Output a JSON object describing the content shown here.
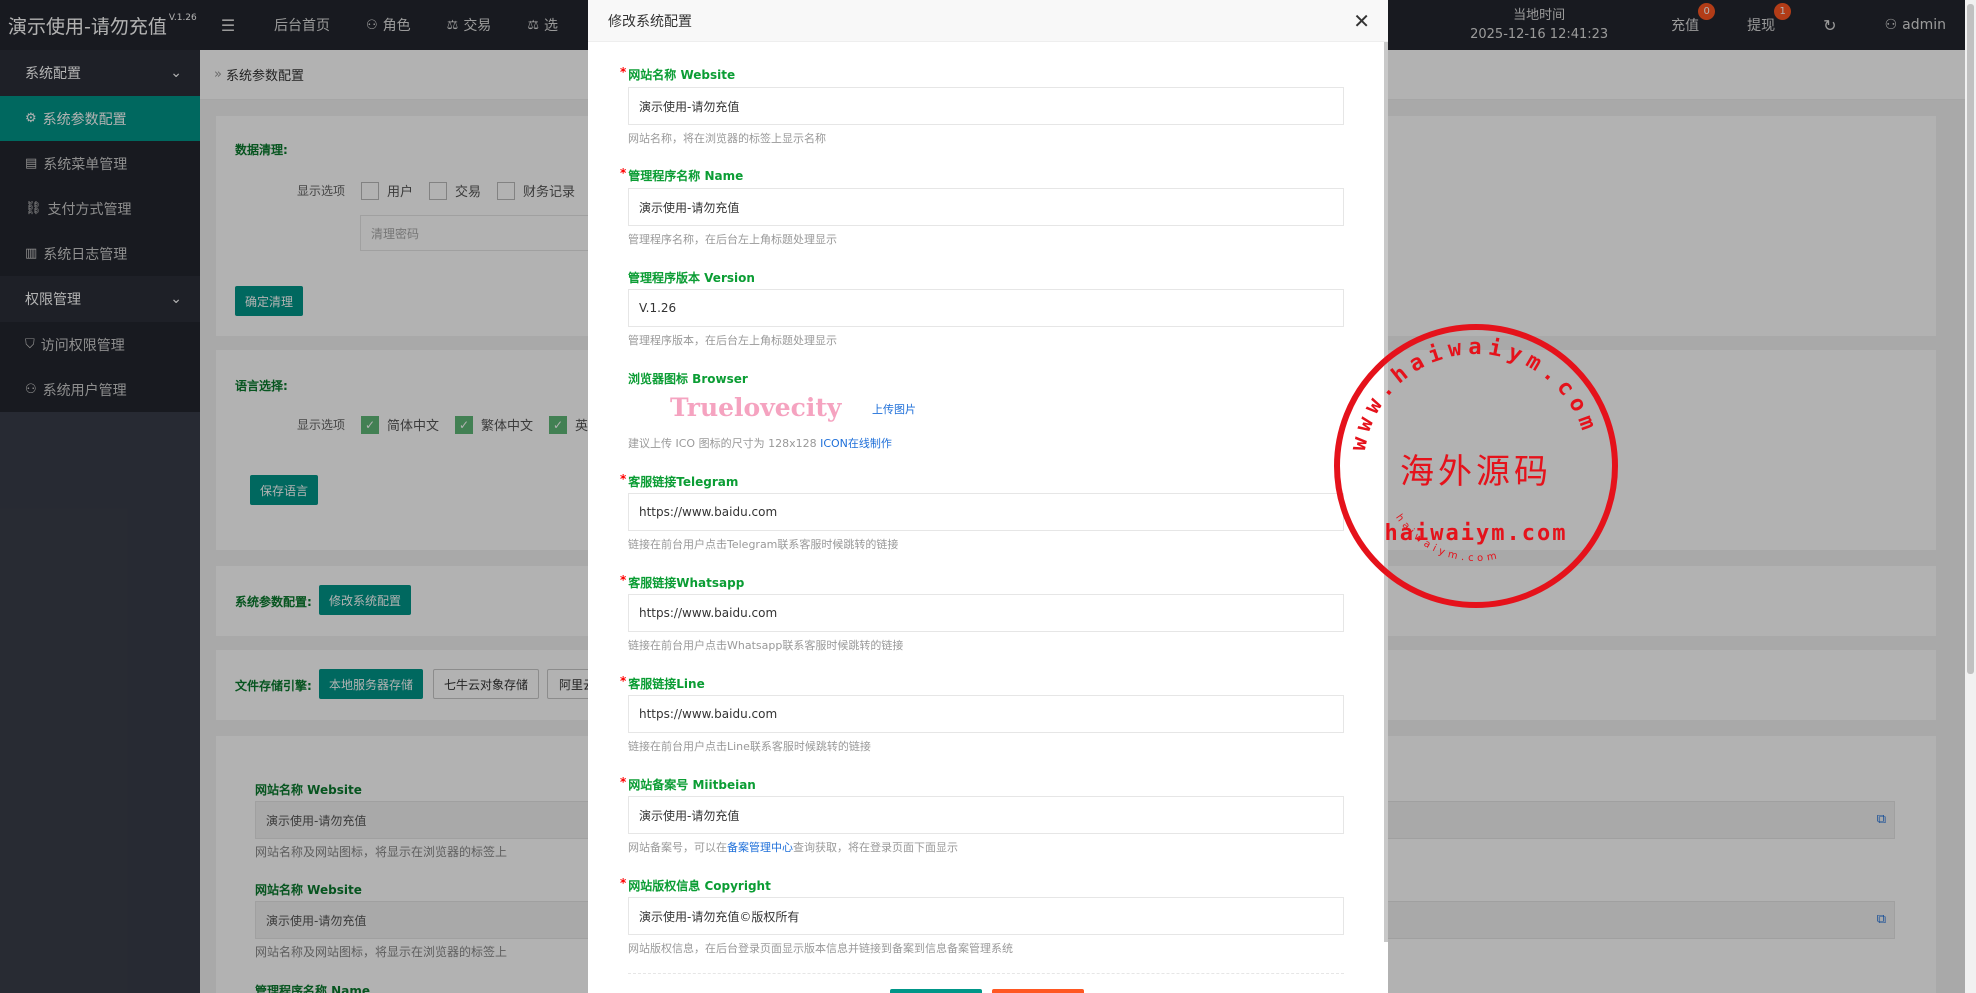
{
  "topbar": {
    "app_title": "演示使用-请勿充值",
    "version": "V.1.26",
    "nav": [
      {
        "label": "后台首页",
        "icon": "home-icon"
      },
      {
        "label": "角色",
        "icon": "user-icon"
      },
      {
        "label": "交易",
        "icon": "scale-icon"
      },
      {
        "label": "选",
        "icon": "scale-icon"
      }
    ],
    "clock_label": "当地时间",
    "clock_value": "2025-12-16 12:41:23",
    "recharge_label": "充值",
    "recharge_badge": "0",
    "withdraw_label": "提现",
    "withdraw_badge": "1",
    "user_label": "admin"
  },
  "sidebar": {
    "group1": "系统配置",
    "items1": [
      "系统参数配置",
      "系统菜单管理",
      "支付方式管理",
      "系统日志管理"
    ],
    "group2": "权限管理",
    "items2": [
      "访问权限管理",
      "系统用户管理"
    ]
  },
  "main": {
    "breadcrumb": "系统参数配置",
    "clean_label": "数据清理:",
    "display_options": "显示选项",
    "clean_options": [
      "用户",
      "交易",
      "财务记录"
    ],
    "clean_password_placeholder": "清理密码",
    "confirm_clean": "确定清理",
    "lang_label": "语言选择:",
    "lang_options": [
      "简体中文",
      "繁体中文",
      "英"
    ],
    "save_lang": "保存语言",
    "sys_config_label": "系统参数配置:",
    "edit_config_btn": "修改系统配置",
    "storage_label": "文件存储引擎:",
    "storage_options": [
      "本地服务器存储",
      "七牛云对象存储",
      "阿里云"
    ],
    "bg_fields": [
      {
        "label": "网站名称 Website",
        "value": "演示使用-请勿充值",
        "hint": "网站名称及网站图标，将显示在浏览器的标签上"
      },
      {
        "label": "网站名称 Website",
        "value": "演示使用-请勿充值",
        "hint": "网站名称及网站图标，将显示在浏览器的标签上"
      },
      {
        "label": "管理程序名称 Name"
      }
    ]
  },
  "modal": {
    "title": "修改系统配置",
    "fields": [
      {
        "label": "网站名称 Website",
        "required": true,
        "value": "演示使用-请勿充值",
        "hint": "网站名称，将在浏览器的标签上显示名称"
      },
      {
        "label": "管理程序名称 Name",
        "required": true,
        "value": "演示使用-请勿充值",
        "hint": "管理程序名称，在后台左上角标题处理显示"
      },
      {
        "label": "管理程序版本 Version",
        "required": false,
        "value": "V.1.26",
        "hint": "管理程序版本，在后台左上角标题处理显示"
      },
      {
        "label": "客服链接Telegram",
        "required": true,
        "value": "https://www.baidu.com",
        "hint": "链接在前台用户点击Telegram联系客服时候跳转的链接"
      },
      {
        "label": "客服链接Whatsapp",
        "required": true,
        "value": "https://www.baidu.com",
        "hint": "链接在前台用户点击Whatsapp联系客服时候跳转的链接"
      },
      {
        "label": "客服链接Line",
        "required": true,
        "value": "https://www.baidu.com",
        "hint": "链接在前台用户点击Line联系客服时候跳转的链接"
      },
      {
        "label": "网站备案号 Miitbeian",
        "required": true,
        "value": "演示使用-请勿充值",
        "hint_pre": "网站备案号，可以在",
        "hint_link": "备案管理中心",
        "hint_post": "查询获取，将在登录页面下面显示"
      },
      {
        "label": "网站版权信息 Copyright",
        "required": true,
        "value": "演示使用-请勿充值©版权所有",
        "hint": "网站版权信息，在后台登录页面显示版本信息并链接到备案到信息备案管理系统"
      }
    ],
    "browser_icon_label": "浏览器图标 Browser",
    "browser_icon_text": "Truelovecity",
    "upload_label": "上传图片",
    "icon_hint_pre": "建议上传 ICO 图标的尺寸为 128x128 ",
    "icon_hint_link": "ICON在线制作"
  },
  "watermark": {
    "arc_text": "www.haiwaiym.com",
    "center_text": "海外源码",
    "domain_text": "haiwaiym.com",
    "small_text": "haiwaiym.com"
  },
  "colors": {
    "accent": "#009688",
    "topbar": "#23262e",
    "sidebar": "#393d49",
    "label_green": "#0b9d34",
    "stamp_red": "#e5121b"
  }
}
